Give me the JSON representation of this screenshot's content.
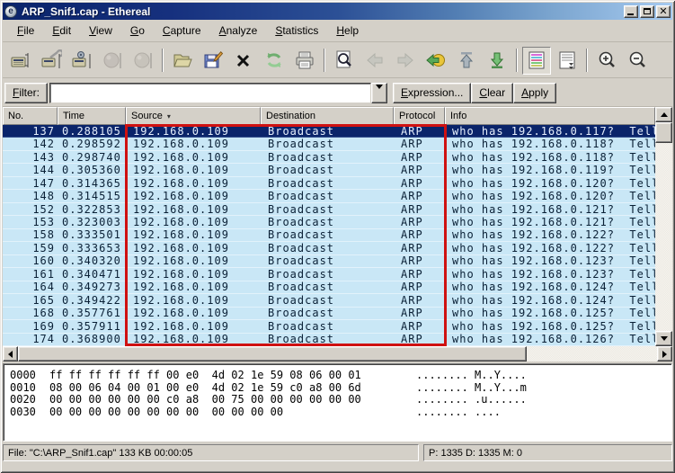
{
  "window": {
    "title": "ARP_Snif1.cap - Ethereal",
    "app_icon_letter": "e"
  },
  "menu": {
    "items": [
      "File",
      "Edit",
      "View",
      "Go",
      "Capture",
      "Analyze",
      "Statistics",
      "Help"
    ]
  },
  "toolbar": {
    "groups": [
      [
        {
          "name": "interface-list",
          "enabled": true
        },
        {
          "name": "capture-options",
          "enabled": true
        },
        {
          "name": "capture-start",
          "enabled": true
        },
        {
          "name": "capture-stop",
          "enabled": false
        },
        {
          "name": "capture-restart",
          "enabled": false
        }
      ],
      [
        {
          "name": "file-open",
          "enabled": true
        },
        {
          "name": "file-save-as",
          "enabled": true
        },
        {
          "name": "file-close",
          "enabled": true
        },
        {
          "name": "reload",
          "enabled": true
        },
        {
          "name": "print",
          "enabled": true
        }
      ],
      [
        {
          "name": "find-packet",
          "enabled": true
        },
        {
          "name": "go-back",
          "enabled": false
        },
        {
          "name": "go-forward",
          "enabled": false
        },
        {
          "name": "go-to-packet",
          "enabled": true
        },
        {
          "name": "go-to-top",
          "enabled": true
        },
        {
          "name": "go-to-bottom",
          "enabled": true
        }
      ],
      [
        {
          "name": "colorize",
          "enabled": true,
          "pressed": true
        },
        {
          "name": "auto-scroll",
          "enabled": true
        }
      ],
      [
        {
          "name": "zoom-in",
          "enabled": true
        },
        {
          "name": "zoom-out",
          "enabled": true
        }
      ]
    ]
  },
  "filter": {
    "label": "Filter:",
    "value": "",
    "expression_label": "Expression...",
    "clear_label": "Clear",
    "apply_label": "Apply"
  },
  "packet_list": {
    "columns": [
      "No.",
      "Time",
      "Source",
      "Destination",
      "Protocol",
      "Info"
    ],
    "sorted_by": "Source",
    "sort_glyph": "▾",
    "rows": [
      {
        "no": "137",
        "time": "0.288105",
        "source": "192.168.0.109",
        "destination": "Broadcast",
        "protocol": "ARP",
        "info": "who has 192.168.0.117?  Tell",
        "selected": true
      },
      {
        "no": "142",
        "time": "0.298592",
        "source": "192.168.0.109",
        "destination": "Broadcast",
        "protocol": "ARP",
        "info": "who has 192.168.0.118?  Tell",
        "selected": false
      },
      {
        "no": "143",
        "time": "0.298740",
        "source": "192.168.0.109",
        "destination": "Broadcast",
        "protocol": "ARP",
        "info": "who has 192.168.0.118?  Tell",
        "selected": false
      },
      {
        "no": "144",
        "time": "0.305360",
        "source": "192.168.0.109",
        "destination": "Broadcast",
        "protocol": "ARP",
        "info": "who has 192.168.0.119?  Tell",
        "selected": false
      },
      {
        "no": "147",
        "time": "0.314365",
        "source": "192.168.0.109",
        "destination": "Broadcast",
        "protocol": "ARP",
        "info": "who has 192.168.0.120?  Tell",
        "selected": false
      },
      {
        "no": "148",
        "time": "0.314515",
        "source": "192.168.0.109",
        "destination": "Broadcast",
        "protocol": "ARP",
        "info": "who has 192.168.0.120?  Tell",
        "selected": false
      },
      {
        "no": "152",
        "time": "0.322853",
        "source": "192.168.0.109",
        "destination": "Broadcast",
        "protocol": "ARP",
        "info": "who has 192.168.0.121?  Tell",
        "selected": false
      },
      {
        "no": "153",
        "time": "0.323003",
        "source": "192.168.0.109",
        "destination": "Broadcast",
        "protocol": "ARP",
        "info": "who has 192.168.0.121?  Tell",
        "selected": false
      },
      {
        "no": "158",
        "time": "0.333501",
        "source": "192.168.0.109",
        "destination": "Broadcast",
        "protocol": "ARP",
        "info": "who has 192.168.0.122?  Tell",
        "selected": false
      },
      {
        "no": "159",
        "time": "0.333653",
        "source": "192.168.0.109",
        "destination": "Broadcast",
        "protocol": "ARP",
        "info": "who has 192.168.0.122?  Tell",
        "selected": false
      },
      {
        "no": "160",
        "time": "0.340320",
        "source": "192.168.0.109",
        "destination": "Broadcast",
        "protocol": "ARP",
        "info": "who has 192.168.0.123?  Tell",
        "selected": false
      },
      {
        "no": "161",
        "time": "0.340471",
        "source": "192.168.0.109",
        "destination": "Broadcast",
        "protocol": "ARP",
        "info": "who has 192.168.0.123?  Tell",
        "selected": false
      },
      {
        "no": "164",
        "time": "0.349273",
        "source": "192.168.0.109",
        "destination": "Broadcast",
        "protocol": "ARP",
        "info": "who has 192.168.0.124?  Tell",
        "selected": false
      },
      {
        "no": "165",
        "time": "0.349422",
        "source": "192.168.0.109",
        "destination": "Broadcast",
        "protocol": "ARP",
        "info": "who has 192.168.0.124?  Tell",
        "selected": false
      },
      {
        "no": "168",
        "time": "0.357761",
        "source": "192.168.0.109",
        "destination": "Broadcast",
        "protocol": "ARP",
        "info": "who has 192.168.0.125?  Tell",
        "selected": false
      },
      {
        "no": "169",
        "time": "0.357911",
        "source": "192.168.0.109",
        "destination": "Broadcast",
        "protocol": "ARP",
        "info": "who has 192.168.0.125?  Tell",
        "selected": false
      },
      {
        "no": "174",
        "time": "0.368900",
        "source": "192.168.0.109",
        "destination": "Broadcast",
        "protocol": "ARP",
        "info": "who has 192.168.0.126?  Tell",
        "selected": false
      }
    ]
  },
  "hex_view": {
    "lines": [
      {
        "offset": "0000",
        "hex": "ff ff ff ff ff ff 00 e0  4d 02 1e 59 08 06 00 01",
        "ascii": "........ M..Y...."
      },
      {
        "offset": "0010",
        "hex": "08 00 06 04 00 01 00 e0  4d 02 1e 59 c0 a8 00 6d",
        "ascii": "........ M..Y...m"
      },
      {
        "offset": "0020",
        "hex": "00 00 00 00 00 00 c0 a8  00 75 00 00 00 00 00 00",
        "ascii": "........ .u......"
      },
      {
        "offset": "0030",
        "hex": "00 00 00 00 00 00 00 00  00 00 00 00",
        "ascii": "........ ...."
      }
    ]
  },
  "status_bar": {
    "left": "File: \"C:\\ARP_Snif1.cap\" 133 KB 00:00:05",
    "right": "P: 1335 D: 1335 M: 0"
  },
  "colors": {
    "selection": "#0a246a",
    "row_background": "#c9e7f6",
    "highlight_box": "#cf1111",
    "titlebar_left": "#0a246a",
    "titlebar_right": "#a6caf0"
  }
}
